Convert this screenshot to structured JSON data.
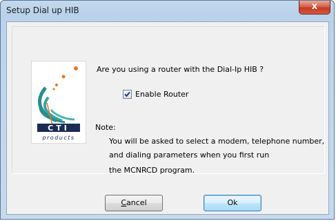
{
  "window": {
    "title": "Setup Dial up HIB",
    "close_glyph": "x"
  },
  "logo": {
    "text_main": "CTI",
    "text_sub": "products",
    "colors": {
      "teal": "#2a8c8a",
      "orange": "#e8761e",
      "dark": "#1c2b56"
    }
  },
  "content": {
    "question": "Are you using a router with the Dial-Ip HIB ?",
    "checkbox": {
      "label": "Enable Router",
      "checked": true
    },
    "note_heading": "Note:",
    "note_lines": [
      "You will be asked to select a modem, telephone number,",
      "and dialing parameters when you first run",
      "the MCNRCD program."
    ]
  },
  "buttons": {
    "cancel_label_first": "C",
    "cancel_label_rest": "ancel",
    "ok_label": "Ok"
  }
}
